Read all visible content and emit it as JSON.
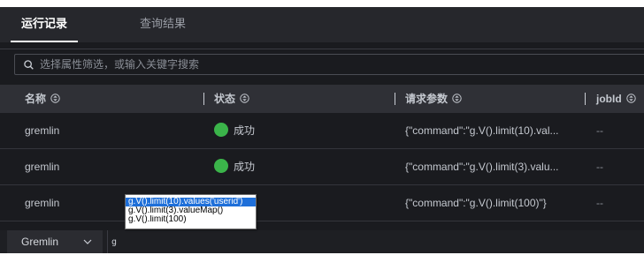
{
  "tabs": [
    {
      "label": "运行记录",
      "active": true
    },
    {
      "label": "查询结果",
      "active": false
    }
  ],
  "search": {
    "placeholder": "选择属性筛选，或输入关键字搜索"
  },
  "table": {
    "columns": [
      "名称",
      "状态",
      "请求参数",
      "jobId"
    ],
    "rows": [
      {
        "name": "gremlin",
        "status": "成功",
        "params": "{\"command\":\"g.V().limit(10).val...",
        "job_id": "--"
      },
      {
        "name": "gremlin",
        "status": "成功",
        "params": "{\"command\":\"g.V().limit(3).valu...",
        "job_id": "--"
      },
      {
        "name": "gremlin",
        "status": "",
        "params": "{\"command\":\"g.V().limit(100)\"}",
        "job_id": "--"
      }
    ]
  },
  "autocomplete": {
    "suggestions": [
      "g.V().limit(10).values('userid')",
      "g.V().limit(3).valueMap()",
      "g.V().limit(100)"
    ],
    "selected_index": 0
  },
  "bottom_bar": {
    "language": "Gremlin",
    "query_text": "g"
  },
  "colors": {
    "background": "#1a1b1f",
    "header": "#2f3036",
    "success": "#3bb44a",
    "selection": "#1e6fd9"
  },
  "icons": {
    "search": "search-icon",
    "sort": "sort-icon",
    "status": "status-dot-icon",
    "dropdown": "chevron-down-icon"
  }
}
